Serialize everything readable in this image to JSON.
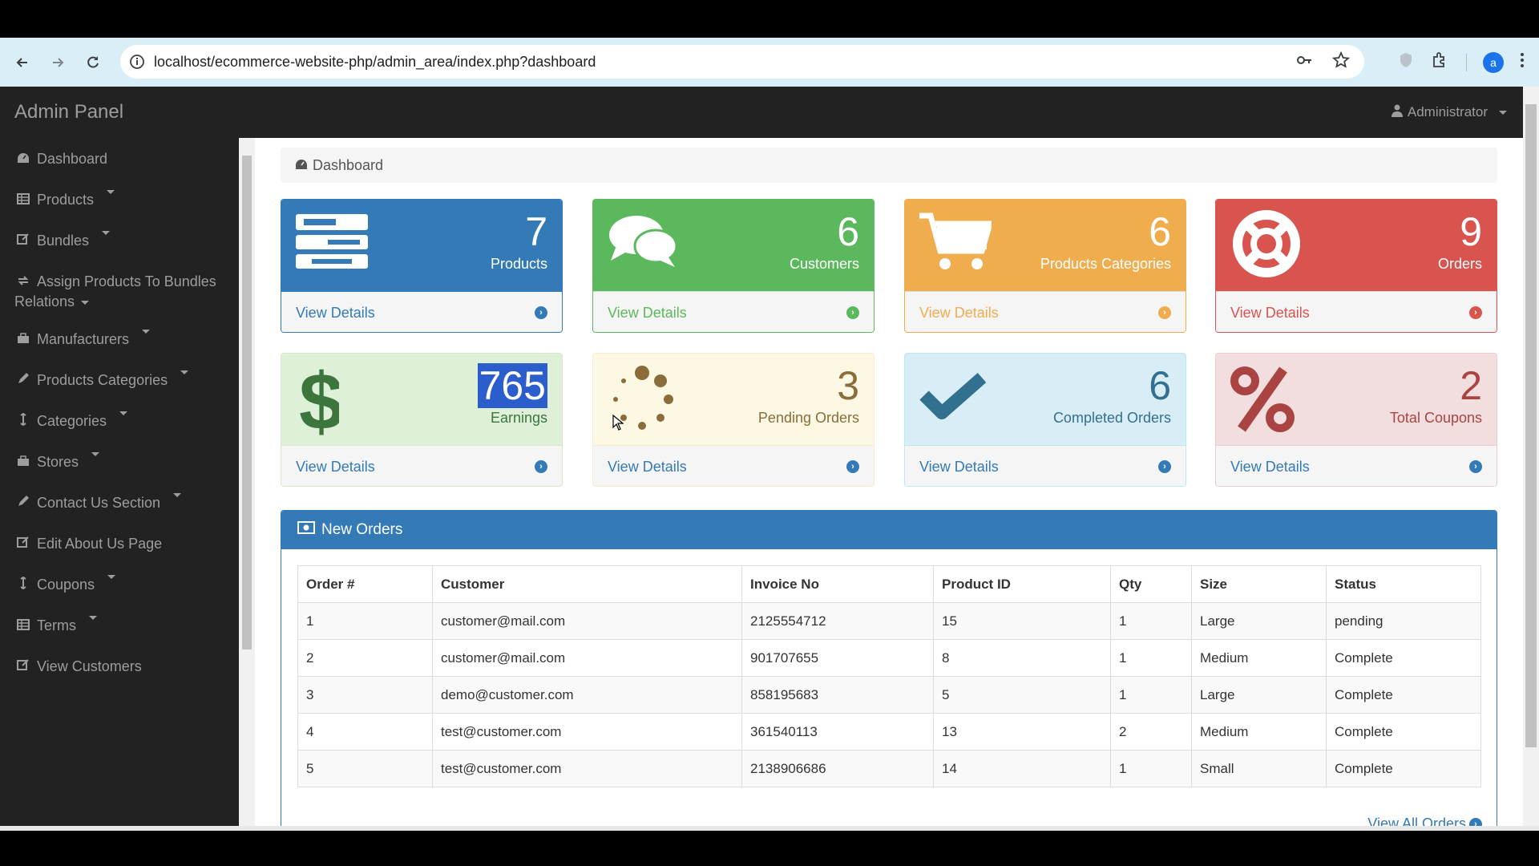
{
  "browser": {
    "url": "localhost/ecommerce-website-php/admin_area/index.php?dashboard",
    "avatar_letter": "a"
  },
  "header": {
    "brand": "Admin Panel",
    "user_menu": "Administrator"
  },
  "sidebar": {
    "items": [
      {
        "label": "Dashboard",
        "icon": "dashboard-icon"
      },
      {
        "label": "Products",
        "icon": "table-icon"
      },
      {
        "label": "Bundles",
        "icon": "edit-icon"
      },
      {
        "label": "Assign Products To Bundles",
        "label2": "Relations",
        "icon": "refresh-icon"
      },
      {
        "label": "Manufacturers",
        "icon": "briefcase-icon"
      },
      {
        "label": "Products Categories",
        "icon": "pencil-icon"
      },
      {
        "label": "Categories",
        "icon": "arrows-v-icon"
      },
      {
        "label": "Stores",
        "icon": "briefcase-icon"
      },
      {
        "label": "Contact Us Section",
        "icon": "pencil-icon"
      },
      {
        "label": "Edit About Us Page",
        "icon": "edit-icon"
      },
      {
        "label": "Coupons",
        "icon": "arrows-v-icon"
      },
      {
        "label": "Terms",
        "icon": "table-icon"
      },
      {
        "label": "View Customers",
        "icon": "edit-icon"
      }
    ]
  },
  "breadcrumb": "Dashboard",
  "panels": [
    {
      "value": "7",
      "label": "Products",
      "link": "View Details",
      "color": "#337ab7",
      "icon": "tasks-icon"
    },
    {
      "value": "6",
      "label": "Customers",
      "link": "View Details",
      "color": "#5cb85c",
      "icon": "comments-icon"
    },
    {
      "value": "6",
      "label": "Products Categories",
      "link": "View Details",
      "color": "#f0ad4e",
      "icon": "shopping-cart-icon"
    },
    {
      "value": "9",
      "label": "Orders",
      "link": "View Details",
      "color": "#d9534f",
      "icon": "support-icon"
    },
    {
      "value": "765",
      "label": "Earnings",
      "link": "View Details",
      "color": "#3c763d",
      "icon": "dollar-icon"
    },
    {
      "value": "3",
      "label": "Pending Orders",
      "link": "View Details",
      "color": "#8a6d3b",
      "icon": "spinner-icon"
    },
    {
      "value": "6",
      "label": "Completed Orders",
      "link": "View Details",
      "color": "#31708f",
      "icon": "check-icon"
    },
    {
      "value": "2",
      "label": "Total Coupons",
      "link": "View Details",
      "color": "#a94442",
      "icon": "percent-icon"
    }
  ],
  "orders": {
    "title": "New Orders",
    "columns": [
      "Order #",
      "Customer",
      "Invoice No",
      "Product ID",
      "Qty",
      "Size",
      "Status"
    ],
    "rows": [
      [
        "1",
        "customer@mail.com",
        "2125554712",
        "15",
        "1",
        "Large",
        "pending"
      ],
      [
        "2",
        "customer@mail.com",
        "901707655",
        "8",
        "1",
        "Medium",
        "Complete"
      ],
      [
        "3",
        "demo@customer.com",
        "858195683",
        "5",
        "1",
        "Large",
        "Complete"
      ],
      [
        "4",
        "test@customer.com",
        "361540113",
        "13",
        "2",
        "Medium",
        "Complete"
      ],
      [
        "5",
        "test@customer.com",
        "2138906686",
        "14",
        "1",
        "Small",
        "Complete"
      ]
    ],
    "view_all": "View All Orders"
  }
}
